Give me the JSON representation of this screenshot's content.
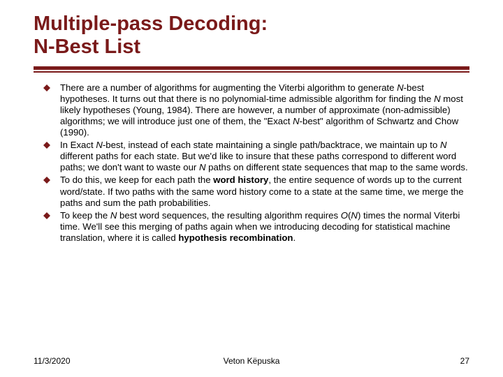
{
  "title_line1": "Multiple-pass Decoding:",
  "title_line2": "N-Best List",
  "bullets": [
    {
      "pre1": "There are a number of algorithms for augmenting the Viterbi algorithm to generate ",
      "i1": "N",
      "mid1": "-best hypotheses. It turns out that there is no polynomial-time admissible algorithm for finding the ",
      "i2": "N",
      "mid2": " most likely hypotheses (Young, 1984). There are however, a number of approximate (non-admissible) algorithms; we will introduce just one of them, the \"Exact ",
      "i3": "N",
      "post1": "-best\" algorithm of Schwartz and Chow (1990)."
    },
    {
      "pre1": "In Exact ",
      "i1": "N",
      "mid1": "-best, instead of each state maintaining a single path/backtrace, we maintain up to ",
      "i2": "N",
      "mid2": " different paths for each state. But we'd like to insure that these paths correspond to different word paths; we don't want to waste our ",
      "i3": "N",
      "post1": " paths on different state sequences that map to the same words."
    },
    {
      "pre1": "To do this, we keep for each path the ",
      "b1": "word history",
      "post1": ", the entire sequence of words up to the current word/state. If two paths with the same word history come to a state at the same time, we merge the paths and sum the path probabilities."
    },
    {
      "pre1": "To keep the ",
      "i1": "N",
      "mid1": " best word sequences, the resulting algorithm requires ",
      "i2": "O",
      "mid2": "(",
      "i3": "N",
      "mid3": ") times the normal Viterbi time. We'll see this merging of paths again when we introducing decoding for statistical machine translation, where it is called ",
      "b1": "hypothesis recombination",
      "post1": "."
    }
  ],
  "footer": {
    "date": "11/3/2020",
    "author": "Veton Këpuska",
    "page": "27"
  }
}
